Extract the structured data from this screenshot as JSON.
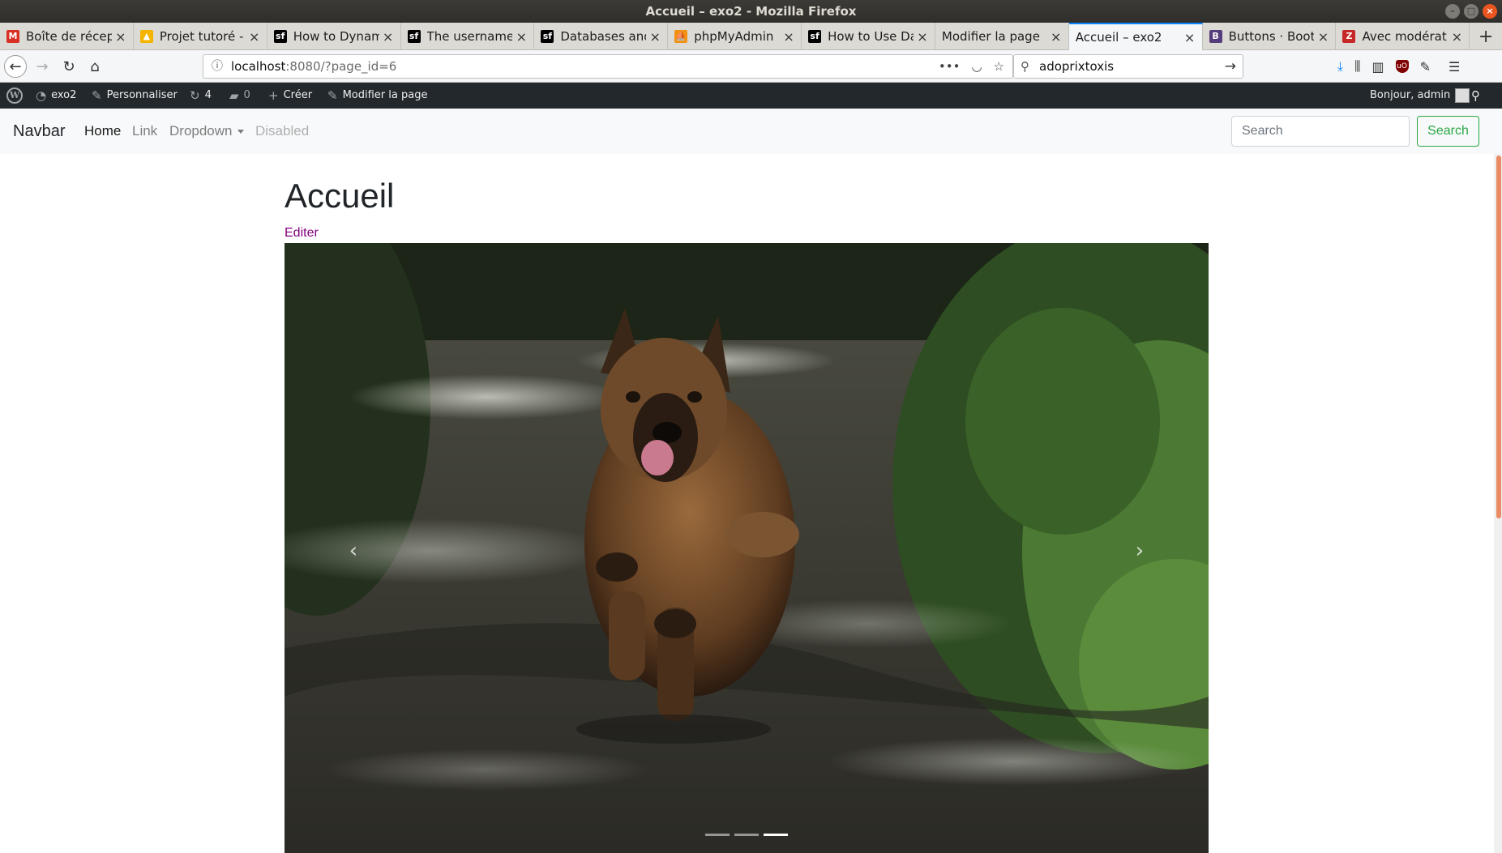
{
  "window": {
    "title": "Accueil – exo2 - Mozilla Firefox"
  },
  "tabs": [
    {
      "label": "Boîte de récept",
      "icon": "gmail-icon",
      "color": "#d93025",
      "glyph": "M"
    },
    {
      "label": "Projet tutoré - ",
      "icon": "google-drive-icon",
      "color": "#f4b400",
      "glyph": "▲"
    },
    {
      "label": "How to Dynami",
      "icon": "symfony-icon",
      "color": "#000000",
      "glyph": "sf"
    },
    {
      "label": "The username ",
      "icon": "symfony-icon",
      "color": "#000000",
      "glyph": "sf"
    },
    {
      "label": "Databases and ",
      "icon": "symfony-icon",
      "color": "#000000",
      "glyph": "sf"
    },
    {
      "label": "phpMyAdmin",
      "icon": "phpmyadmin-icon",
      "color": "#f29111",
      "glyph": "⛵"
    },
    {
      "label": "How to Use Dat",
      "icon": "symfony-icon",
      "color": "#000000",
      "glyph": "sf"
    },
    {
      "label": "Modifier la page ",
      "icon": "",
      "color": "",
      "glyph": ""
    },
    {
      "label": "Accueil – exo2",
      "icon": "",
      "color": "",
      "glyph": "",
      "active": true
    },
    {
      "label": "Buttons · Boots",
      "icon": "bootstrap-icon",
      "color": "#563d7c",
      "glyph": "B"
    },
    {
      "label": "Avec modératio",
      "icon": "app-icon",
      "color": "#c62828",
      "glyph": "Z"
    }
  ],
  "urlbar": {
    "host": "localhost",
    "rest": ":8080/?page_id=6"
  },
  "searchbar": {
    "value": "adoprixtoxis"
  },
  "adminbar": {
    "site": "exo2",
    "customize": "Personnaliser",
    "updates": "4",
    "comments": "0",
    "new": "Créer",
    "edit": "Modifier la page",
    "greeting": "Bonjour, admin"
  },
  "navbar": {
    "brand": "Navbar",
    "links": {
      "home": "Home",
      "link": "Link",
      "dropdown": "Dropdown",
      "disabled": "Disabled"
    },
    "search_placeholder": "Search",
    "search_button": "Search"
  },
  "page": {
    "title": "Accueil",
    "edit_link": "Editer"
  },
  "carousel": {
    "slide_count": 3,
    "active_index": 2
  },
  "colors": {
    "accent": "#0a84ff",
    "success": "#28a745",
    "visited": "#800080",
    "adminbar": "#23282d"
  }
}
